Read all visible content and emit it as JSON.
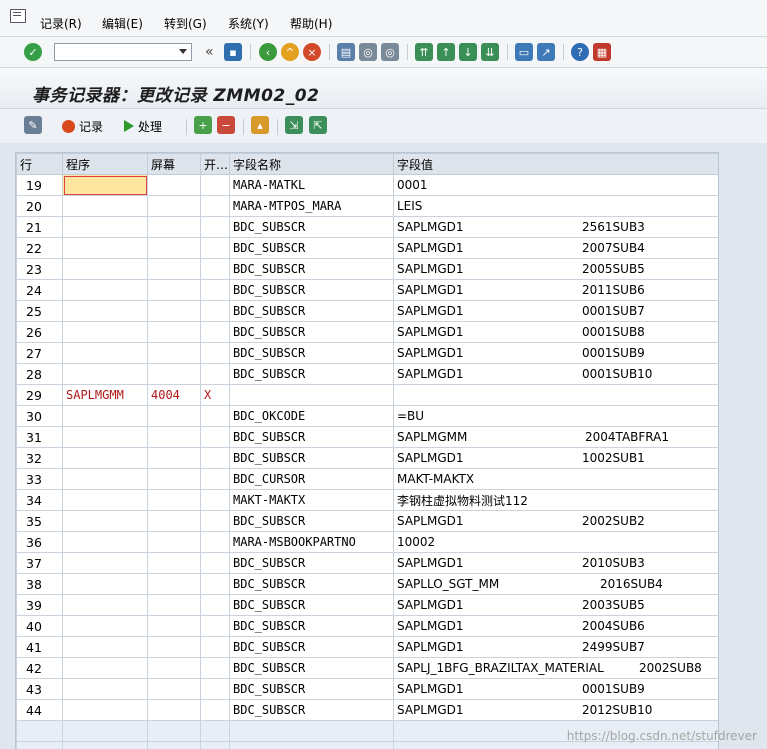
{
  "menu": [
    {
      "label": "记录(R)"
    },
    {
      "label": "编辑(E)"
    },
    {
      "label": "转到(G)"
    },
    {
      "label": "系统(Y)"
    },
    {
      "label": "帮助(H)"
    }
  ],
  "toolbar": {
    "command_value": "",
    "back_label": "«"
  },
  "title": "事务记录器：更改记录 ZMM02_02",
  "app_toolbar": {
    "record_label": "记录",
    "process_label": "处理"
  },
  "table": {
    "headers": [
      "行",
      "程序",
      "屏幕",
      "开…",
      "字段名称",
      "字段值"
    ],
    "rows": [
      {
        "line": "19",
        "program": "",
        "screen": "",
        "start": "",
        "field": "MARA-MATKL",
        "value": "0001",
        "sub": ""
      },
      {
        "line": "20",
        "program": "",
        "screen": "",
        "start": "",
        "field": "MARA-MTPOS_MARA",
        "value": "LEIS",
        "sub": ""
      },
      {
        "line": "21",
        "program": "",
        "screen": "",
        "start": "",
        "field": "BDC_SUBSCR",
        "value": "SAPLMGD1",
        "sub": "2561SUB3"
      },
      {
        "line": "22",
        "program": "",
        "screen": "",
        "start": "",
        "field": "BDC_SUBSCR",
        "value": "SAPLMGD1",
        "sub": "2007SUB4"
      },
      {
        "line": "23",
        "program": "",
        "screen": "",
        "start": "",
        "field": "BDC_SUBSCR",
        "value": "SAPLMGD1",
        "sub": "2005SUB5"
      },
      {
        "line": "24",
        "program": "",
        "screen": "",
        "start": "",
        "field": "BDC_SUBSCR",
        "value": "SAPLMGD1",
        "sub": "2011SUB6"
      },
      {
        "line": "25",
        "program": "",
        "screen": "",
        "start": "",
        "field": "BDC_SUBSCR",
        "value": "SAPLMGD1",
        "sub": "0001SUB7"
      },
      {
        "line": "26",
        "program": "",
        "screen": "",
        "start": "",
        "field": "BDC_SUBSCR",
        "value": "SAPLMGD1",
        "sub": "0001SUB8"
      },
      {
        "line": "27",
        "program": "",
        "screen": "",
        "start": "",
        "field": "BDC_SUBSCR",
        "value": "SAPLMGD1",
        "sub": "0001SUB9"
      },
      {
        "line": "28",
        "program": "",
        "screen": "",
        "start": "",
        "field": "BDC_SUBSCR",
        "value": "SAPLMGD1",
        "sub": "0001SUB10"
      },
      {
        "line": "29",
        "program": "SAPLMGMM",
        "screen": "4004",
        "start": "X",
        "field": "",
        "value": "",
        "sub": ""
      },
      {
        "line": "30",
        "program": "",
        "screen": "",
        "start": "",
        "field": "BDC_OKCODE",
        "value": "=BU",
        "sub": ""
      },
      {
        "line": "31",
        "program": "",
        "screen": "",
        "start": "",
        "field": "BDC_SUBSCR",
        "value": "SAPLMGMM",
        "sub": "2004TABFRA1"
      },
      {
        "line": "32",
        "program": "",
        "screen": "",
        "start": "",
        "field": "BDC_SUBSCR",
        "value": "SAPLMGD1",
        "sub": "1002SUB1"
      },
      {
        "line": "33",
        "program": "",
        "screen": "",
        "start": "",
        "field": "BDC_CURSOR",
        "value": "MAKT-MAKTX",
        "sub": ""
      },
      {
        "line": "34",
        "program": "",
        "screen": "",
        "start": "",
        "field": "MAKT-MAKTX",
        "value": "李钢柱虚拟物料测试112",
        "sub": ""
      },
      {
        "line": "35",
        "program": "",
        "screen": "",
        "start": "",
        "field": "BDC_SUBSCR",
        "value": "SAPLMGD1",
        "sub": "2002SUB2"
      },
      {
        "line": "36",
        "program": "",
        "screen": "",
        "start": "",
        "field": "MARA-MSBOOKPARTNO",
        "value": "10002",
        "sub": ""
      },
      {
        "line": "37",
        "program": "",
        "screen": "",
        "start": "",
        "field": "BDC_SUBSCR",
        "value": "SAPLMGD1",
        "sub": "2010SUB3"
      },
      {
        "line": "38",
        "program": "",
        "screen": "",
        "start": "",
        "field": "BDC_SUBSCR",
        "value": "SAPLLO_SGT_MM",
        "sub": "2016SUB4"
      },
      {
        "line": "39",
        "program": "",
        "screen": "",
        "start": "",
        "field": "BDC_SUBSCR",
        "value": "SAPLMGD1",
        "sub": "2003SUB5"
      },
      {
        "line": "40",
        "program": "",
        "screen": "",
        "start": "",
        "field": "BDC_SUBSCR",
        "value": "SAPLMGD1",
        "sub": "2004SUB6"
      },
      {
        "line": "41",
        "program": "",
        "screen": "",
        "start": "",
        "field": "BDC_SUBSCR",
        "value": "SAPLMGD1",
        "sub": "2499SUB7"
      },
      {
        "line": "42",
        "program": "",
        "screen": "",
        "start": "",
        "field": "BDC_SUBSCR",
        "value": "SAPLJ_1BFG_BRAZILTAX_MATERIAL",
        "sub": "2002SUB8"
      },
      {
        "line": "43",
        "program": "",
        "screen": "",
        "start": "",
        "field": "BDC_SUBSCR",
        "value": "SAPLMGD1",
        "sub": "0001SUB9"
      },
      {
        "line": "44",
        "program": "",
        "screen": "",
        "start": "",
        "field": "BDC_SUBSCR",
        "value": "SAPLMGD1",
        "sub": "2012SUB10"
      }
    ]
  },
  "watermark": "https://blog.csdn.net/stufdrever",
  "colors": {
    "program_red": "#b01818",
    "selected_cell": "#ffe6a0",
    "background": "#dfe6ee"
  }
}
